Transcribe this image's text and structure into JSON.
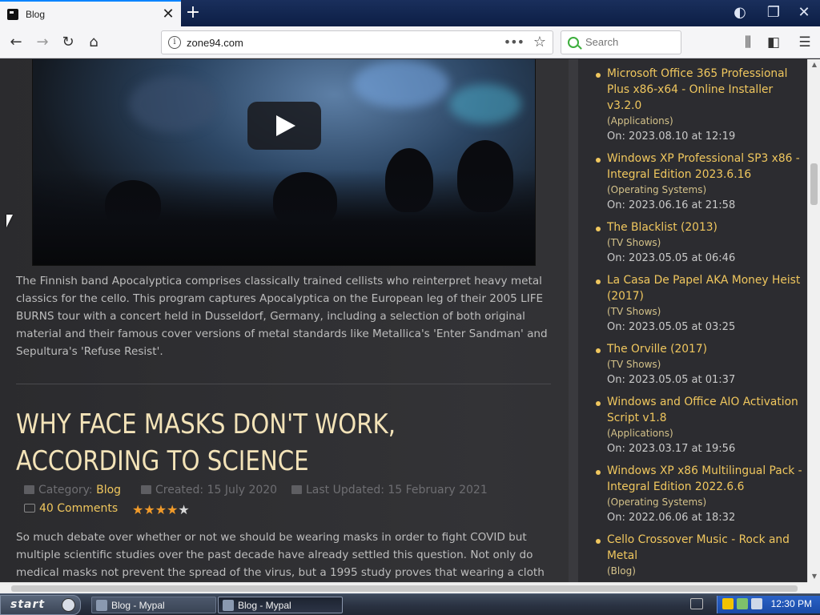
{
  "browser": {
    "tab_title": "Blog",
    "url": "zone94.com",
    "search_placeholder": "Search"
  },
  "video": {
    "description": "The Finnish band Apocalyptica comprises classically trained cellists who reinterpret heavy metal classics for the cello. This program captures Apocalyptica on the European leg of their 2005 LIFE BURNS tour with a concert held in Dusseldorf, Germany, including a selection of both original material and their famous cover versions of metal standards like Metallica's 'Enter Sandman' and Sepultura's 'Refuse Resist'."
  },
  "post": {
    "title": "WHY FACE MASKS DON'T WORK, ACCORDING TO SCIENCE",
    "category_label": "Category:",
    "category": "Blog",
    "created": "Created: 15 July 2020",
    "updated": "Last Updated: 15 February 2021",
    "comments": "40 Comments",
    "rating": 3.5,
    "rating_max": 5,
    "body": "So much debate over whether or not we should be wearing masks in order to fight COVID but multiple scientific studies over the past decade have already settled this question. Not only do medical masks not prevent the spread of the virus, but a 1995 study proves that wearing a cloth"
  },
  "sidebar": {
    "items": [
      {
        "title": "Microsoft Office 365 Professional Plus x86-x64 - Online Installer v3.2.0",
        "category": "(Applications)",
        "date": "On: 2023.08.10 at 12:19"
      },
      {
        "title": "Windows XP Professional SP3 x86 - Integral Edition 2023.6.16",
        "category": "(Operating Systems)",
        "date": "On: 2023.06.16 at 21:58"
      },
      {
        "title": "The Blacklist (2013)",
        "category": "(TV Shows)",
        "date": "On: 2023.05.05 at 06:46"
      },
      {
        "title": "La Casa De Papel AKA Money Heist (2017)",
        "category": "(TV Shows)",
        "date": "On: 2023.05.05 at 03:25"
      },
      {
        "title": "The Orville (2017)",
        "category": "(TV Shows)",
        "date": "On: 2023.05.05 at 01:37"
      },
      {
        "title": "Windows and Office AIO Activation Script v1.8",
        "category": "(Applications)",
        "date": "On: 2023.03.17 at 19:56"
      },
      {
        "title": "Windows XP x86 Multilingual Pack - Integral Edition 2022.6.6",
        "category": "(Operating Systems)",
        "date": "On: 2022.06.06 at 18:32"
      },
      {
        "title": "Cello Crossover Music - Rock and Metal",
        "category": "(Blog)",
        "date": ""
      }
    ]
  },
  "taskbar": {
    "start_label": "start",
    "tasks": [
      "Blog - Mypal",
      "Blog - Mypal"
    ],
    "clock": "12:30 PM"
  },
  "colors": {
    "accent_gold": "#f0c75e",
    "title_cream": "#f3e3b8",
    "page_bg": "#2c2c30"
  }
}
